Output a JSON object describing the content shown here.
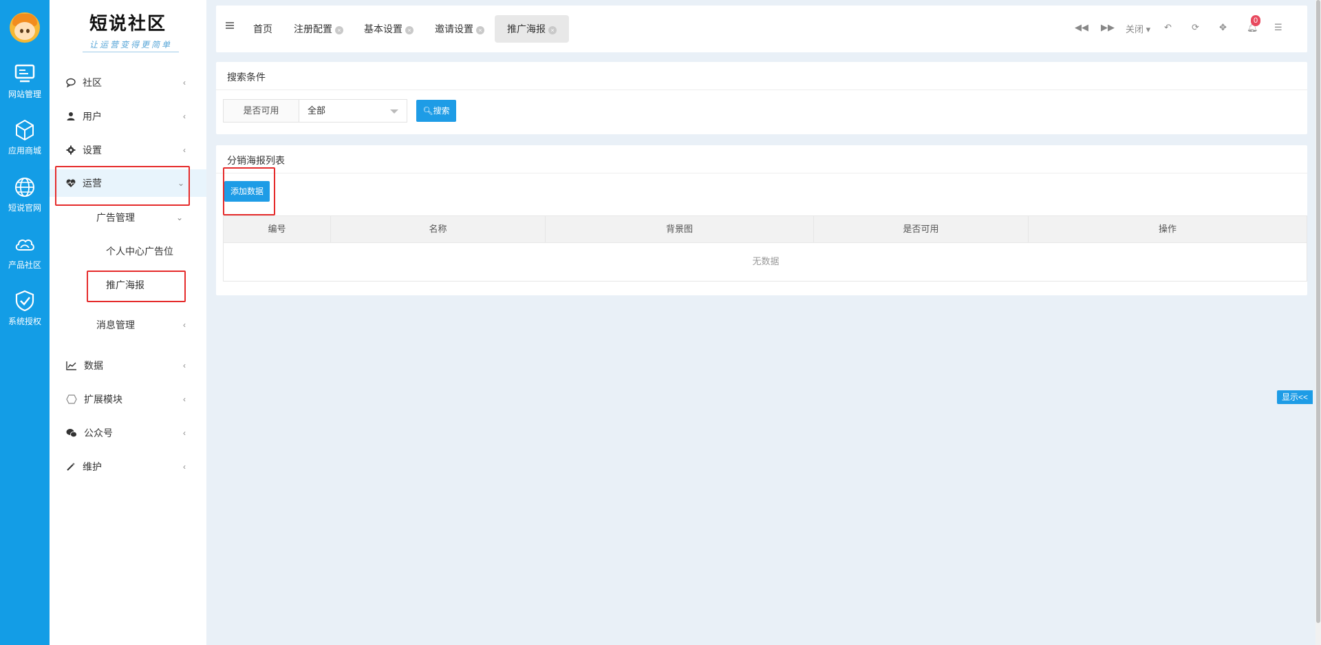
{
  "rail": {
    "items": [
      {
        "label": "网站管理",
        "icon": "monitor-icon"
      },
      {
        "label": "应用商城",
        "icon": "cube-icon"
      },
      {
        "label": "短说官网",
        "icon": "globe-icon"
      },
      {
        "label": "产品社区",
        "icon": "cloud-icon"
      },
      {
        "label": "系统授权",
        "icon": "shield-check-icon"
      }
    ]
  },
  "sidebar": {
    "logo_title": "短说社区",
    "logo_subtitle": "让运营变得更简单",
    "items": [
      {
        "label": "社区",
        "icon": "comment-icon"
      },
      {
        "label": "用户",
        "icon": "user-icon"
      },
      {
        "label": "设置",
        "icon": "gear-icon"
      },
      {
        "label": "运营",
        "icon": "heartbeat-icon"
      },
      {
        "label": "数据",
        "icon": "line-chart-icon"
      },
      {
        "label": "扩展模块",
        "icon": "hexagon-icon"
      },
      {
        "label": "公众号",
        "icon": "wechat-icon"
      },
      {
        "label": "维护",
        "icon": "magic-wand-icon"
      }
    ],
    "sub": {
      "ad_manage": "广告管理",
      "personal_ad": "个人中心广告位",
      "promo_poster": "推广海报",
      "msg_manage": "消息管理"
    }
  },
  "tabs": [
    {
      "label": "首页"
    },
    {
      "label": "注册配置"
    },
    {
      "label": "基本设置"
    },
    {
      "label": "邀请设置"
    },
    {
      "label": "推广海报"
    }
  ],
  "toolbar": {
    "close_label": "关闭",
    "notification_count": "0"
  },
  "search_panel": {
    "title": "搜索条件",
    "field_label": "是否可用",
    "select_value": "全部",
    "search_button": "搜索"
  },
  "list_panel": {
    "title": "分销海报列表",
    "add_button": "添加数据",
    "columns": [
      "编号",
      "名称",
      "背景图",
      "是否可用",
      "操作"
    ],
    "empty_text": "无数据"
  },
  "show_button": "显示<<"
}
